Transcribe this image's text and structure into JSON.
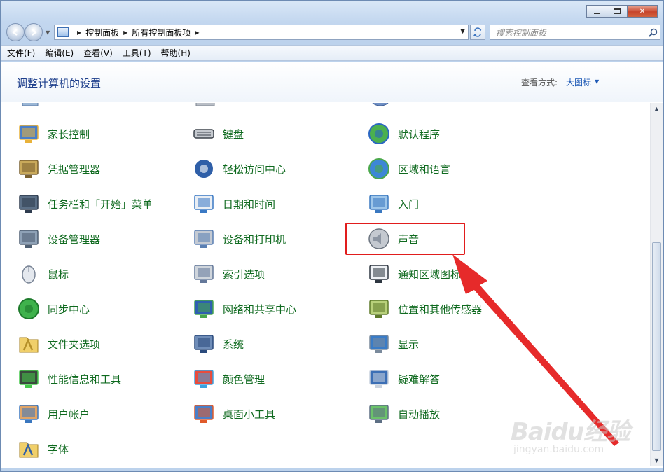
{
  "address": {
    "crumbs": [
      "控制面板",
      "所有控制面板项"
    ]
  },
  "search": {
    "placeholder": "搜索控制面板"
  },
  "menu": [
    "文件(F)",
    "编辑(E)",
    "查看(V)",
    "工具(T)",
    "帮助(H)"
  ],
  "header": {
    "title": "调整计算机的设置",
    "view_label": "查看方式:",
    "view_value": "大图标"
  },
  "items": {
    "col1": [
      "家长控制",
      "凭据管理器",
      "任务栏和「开始」菜单",
      "设备管理器",
      "鼠标",
      "同步中心",
      "文件夹选项",
      "性能信息和工具",
      "用户帐户",
      "字体"
    ],
    "col2": [
      "键盘",
      "轻松访问中心",
      "日期和时间",
      "设备和打印机",
      "索引选项",
      "网络和共享中心",
      "系统",
      "颜色管理",
      "桌面小工具"
    ],
    "col3": [
      "默认程序",
      "区域和语言",
      "入门",
      "声音",
      "通知区域图标",
      "位置和其他传感器",
      "显示",
      "疑难解答",
      "自动播放"
    ]
  },
  "icons": {
    "col1": [
      "parental-controls-icon",
      "credential-manager-icon",
      "taskbar-start-menu-icon",
      "device-manager-icon",
      "mouse-icon",
      "sync-center-icon",
      "folder-options-icon",
      "performance-icon",
      "user-accounts-icon",
      "fonts-icon"
    ],
    "col2": [
      "keyboard-icon",
      "ease-of-access-icon",
      "date-time-icon",
      "devices-printers-icon",
      "indexing-options-icon",
      "network-sharing-icon",
      "system-icon",
      "color-management-icon",
      "desktop-gadgets-icon"
    ],
    "col3": [
      "default-programs-icon",
      "region-language-icon",
      "getting-started-icon",
      "sound-icon",
      "notification-area-icon",
      "location-sensors-icon",
      "display-icon",
      "troubleshooting-icon",
      "autoplay-icon"
    ]
  },
  "watermark": {
    "main": "Baidu经验",
    "sub": "jingyan.baidu.com"
  },
  "colors": {
    "link_green": "#0f6a1f",
    "title_blue": "#1e3f8c",
    "annotation_red": "#e11d1d"
  }
}
